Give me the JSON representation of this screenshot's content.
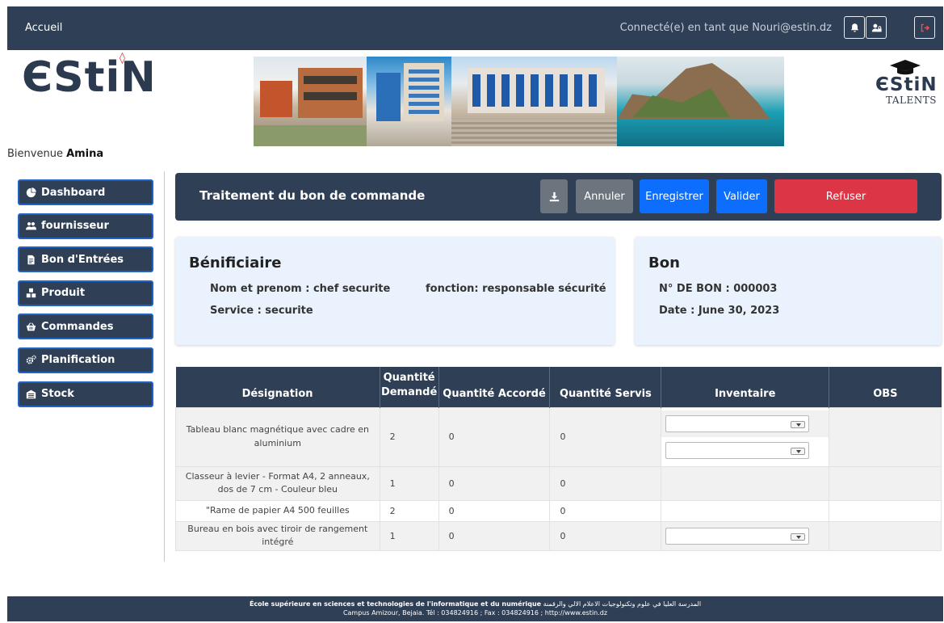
{
  "topbar": {
    "home_link": "Accueil",
    "connected_user": "Connecté(e) en tant que Nouri@estin.dz",
    "icons": [
      "bell-icon",
      "user-lock-icon",
      "logout-icon"
    ]
  },
  "logos": {
    "left": "ЄStiN",
    "left_mark": "◊",
    "right_name": "ЄStiN",
    "right_sub": "TALENTS"
  },
  "welcome": {
    "prefix": "Bienvenue",
    "name": "Amina"
  },
  "sidebar": {
    "items": [
      {
        "label": "Dashboard",
        "icon": "dashboard-icon"
      },
      {
        "label": "fournisseur",
        "icon": "users-icon"
      },
      {
        "label": "Bon d'Entrées",
        "icon": "document-icon"
      },
      {
        "label": "Produit",
        "icon": "boxes-icon"
      },
      {
        "label": "Commandes",
        "icon": "shopping-basket-icon"
      },
      {
        "label": "Planification",
        "icon": "cogs-icon"
      },
      {
        "label": "Stock",
        "icon": "warehouse-icon"
      }
    ]
  },
  "actionbar": {
    "title": "Traitement du bon de commande",
    "download_icon": "download-icon",
    "cancel_label": "Annuler",
    "save_label": "Enregistrer",
    "validate_label": "Valider",
    "refuse_label": "Refuser",
    "colors": {
      "cancel": "#6c757d",
      "primary": "#0d6efd",
      "danger": "#dc3545"
    }
  },
  "beneficiary": {
    "heading": "Bénificiaire",
    "name": "Nom et prenom : chef securite",
    "function": "fonction: responsable sécurité",
    "service": "Service : securite"
  },
  "bon": {
    "heading": "Bon",
    "number": "N° DE BON : 000003",
    "date": "Date : June 30, 2023"
  },
  "table": {
    "headers": {
      "designation": "Désignation",
      "qty_requested_1": "Quantité",
      "qty_requested_2": "Demandé",
      "qty_granted": "Quantité Accordé",
      "qty_served": "Quantité Servis",
      "inventory": "Inventaire",
      "obs": "OBS"
    },
    "rows": [
      {
        "designation": "Tableau blanc magnétique avec cadre en aluminium",
        "requested": "2",
        "granted": "0",
        "served": "0",
        "selects": 2
      },
      {
        "designation": "Classeur à levier - Format A4, 2 anneaux, dos de 7 cm - Couleur bleu",
        "requested": "1",
        "granted": "0",
        "served": "0",
        "selects": 0
      },
      {
        "designation": "\"Rame de papier A4 500 feuilles",
        "requested": "2",
        "granted": "0",
        "served": "0",
        "selects": 0
      },
      {
        "designation": "Bureau en bois avec tiroir de rangement intégré",
        "requested": "1",
        "granted": "0",
        "served": "0",
        "selects": 1
      }
    ]
  },
  "footer": {
    "line1_fr": "École supérieure en sciences et technologies de l'informatique et du numérique",
    "line1_ar": "المدرسة العليا في علوم وتكنولوجيات الاعلام الالي والرقمنة",
    "line2": "Campus Amizour, Bejaia. Tél : 034824916 ; Fax : 034824916 ; http://www.estin.dz"
  },
  "colors": {
    "navy": "#2f3f55",
    "card_bg": "#eaf3fd",
    "sidebar_border": "#1f63c7"
  }
}
